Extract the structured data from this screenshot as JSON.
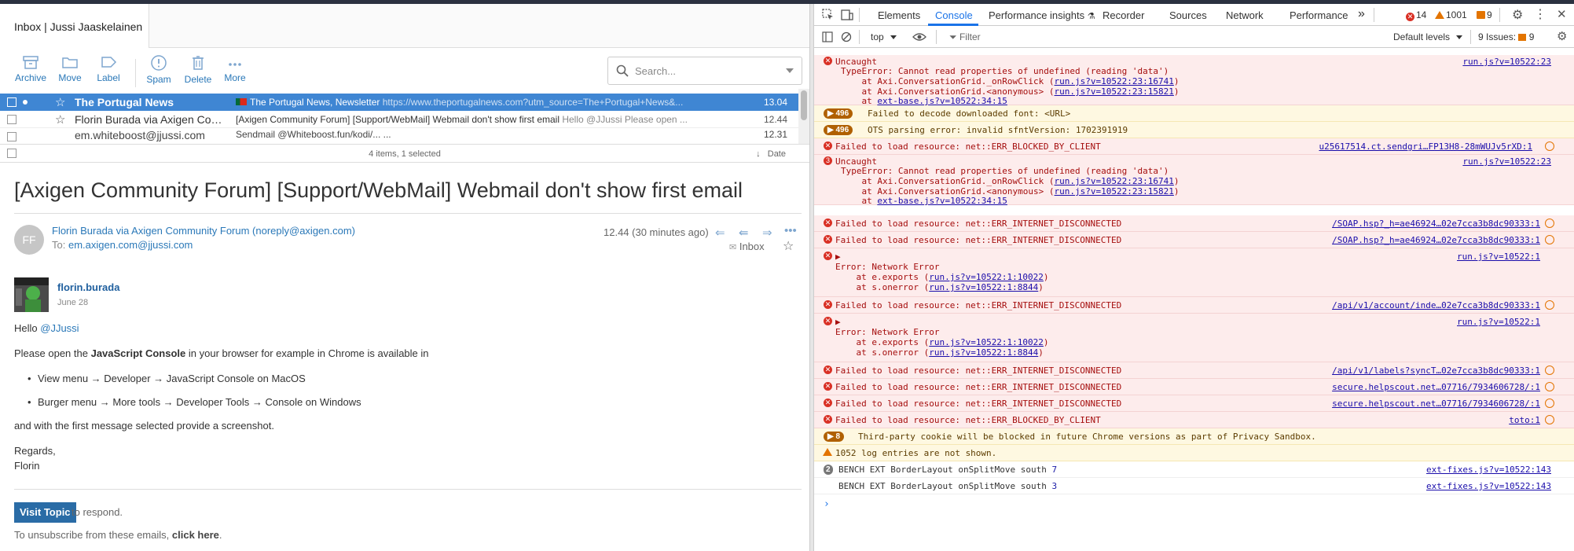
{
  "mail": {
    "tab_title": "Inbox | Jussi Jaaskelainen",
    "toolbar": {
      "archive": "Archive",
      "move": "Move",
      "label": "Label",
      "spam": "Spam",
      "delete": "Delete",
      "more": "More"
    },
    "search": {
      "placeholder": "Search..."
    },
    "rows": [
      {
        "from": "The Portugal News",
        "subject": "The Portugal News, Newsletter",
        "preview": "https://www.theportugalnews.com?utm_source=The+Portugal+News&...",
        "date": "13.04"
      },
      {
        "from": "Florin Burada via Axigen Community Forum",
        "subject": "[Axigen Community Forum] [Support/WebMail] Webmail don't show first email",
        "preview": "Hello @JJussi Please open ...",
        "date": "12.44"
      },
      {
        "from": "em.whiteboost@jjussi.com",
        "subject": "Sendmail @Whiteboost.fun/kodi/... ... ",
        "preview": "",
        "date": "12.31"
      }
    ],
    "status": {
      "count": "4 items, 1 selected",
      "sort": "Date"
    },
    "message": {
      "subject": "[Axigen Community Forum] [Support/WebMail] Webmail don't show first email",
      "avatar_initials": "FF",
      "sender": "Florin Burada via Axigen Community Forum (noreply@axigen.com)",
      "to_label": "To:",
      "to_addr": "em.axigen.com@jjussi.com",
      "time": "12.44 (30 minutes ago)",
      "folder": "Inbox",
      "post_user": "florin.burada",
      "post_date": "June 28",
      "hello": "Hello",
      "mention": "@JJussi",
      "p1_a": "Please open the",
      "p1_b": "JavaScript Console",
      "p1_c": "in your browser for example in Chrome is available in",
      "bullet1": "View menu → Developer → JavaScript Console on MacOS",
      "bullet2": "Burger menu → More tools → Developer Tools → Console on Windows",
      "p2": "and with the first message selected provide a screenshot.",
      "regards": "Regards,",
      "sign": "Florin",
      "visit": "Visit Topic",
      "respond": "to respond.",
      "unsub_a": "To unsubscribe from these emails,",
      "unsub_b": "click here",
      "unsub_c": "."
    }
  },
  "devtools": {
    "tabs": [
      "Elements",
      "Console",
      "Performance insights",
      "Recorder",
      "Sources",
      "Network",
      "Performance"
    ],
    "errors": "14",
    "warnings": "1001",
    "issues_count": "9",
    "context": "top",
    "filter_placeholder": "Filter",
    "levels": "Default levels",
    "issues_label": "9 Issues:",
    "issues_badge": "9",
    "console": {
      "m1": {
        "l1": "Uncaught",
        "l2": "TypeError: Cannot read properties of undefined (reading 'data')",
        "l3a": "    at Axi.ConversationGrid._onRowClick (",
        "l3b": "run.js?v=10522:23:16741",
        "l4a": "    at Axi.ConversationGrid.<anonymous> (",
        "l4b": "run.js?v=10522:23:15821",
        "l5a": "    at ",
        "l5b": "ext-base.js?v=10522:34:15",
        "src": "run.js?v=10522:23"
      },
      "m2": {
        "count": "496",
        "text": "Failed to decode downloaded font: <URL>"
      },
      "m3": {
        "count": "496",
        "text": "OTS parsing error: invalid sfntVersion: 1702391919"
      },
      "m4": {
        "text": "Failed to load resource: net::ERR_BLOCKED_BY_CLIENT",
        "src": "u25617514.ct.sendgri…FP13H8-28mWUJv5rXD:1"
      },
      "m5": {
        "count": "3",
        "l1": "Uncaught",
        "l2": "TypeError: Cannot read properties of undefined (reading 'data')",
        "l3a": "    at Axi.ConversationGrid._onRowClick (",
        "l3b": "run.js?v=10522:23:16741",
        "l4a": "    at Axi.ConversationGrid.<anonymous> (",
        "l4b": "run.js?v=10522:23:15821",
        "l5a": "    at ",
        "l5b": "ext-base.js?v=10522:34:15",
        "src": "run.js?v=10522:23"
      },
      "m6": {
        "text": "Failed to load resource: net::ERR_INTERNET_DISCONNECTED",
        "src": "/SOAP.hsp?_h=ae46924…02e7cca3b8dc90333:1"
      },
      "m7": {
        "text": "Failed to load resource: net::ERR_INTERNET_DISCONNECTED",
        "src": "/SOAP.hsp?_h=ae46924…02e7cca3b8dc90333:1"
      },
      "m8": {
        "l1": "▶",
        "l2": "Error: Network Error",
        "l3a": "    at e.exports (",
        "l3b": "run.js?v=10522:1:10022",
        "l4a": "    at s.onerror (",
        "l4b": "run.js?v=10522:1:8844",
        "src": "run.js?v=10522:1"
      },
      "m9": {
        "text": "Failed to load resource: net::ERR_INTERNET_DISCONNECTED",
        "src": "/api/v1/account/inde…02e7cca3b8dc90333:1"
      },
      "m10": {
        "l1": "▶",
        "l2": "Error: Network Error",
        "l3a": "    at e.exports (",
        "l3b": "run.js?v=10522:1:10022",
        "l4a": "    at s.onerror (",
        "l4b": "run.js?v=10522:1:8844",
        "src": "run.js?v=10522:1"
      },
      "m11": {
        "text": "Failed to load resource: net::ERR_INTERNET_DISCONNECTED",
        "src": "/api/v1/labels?syncT…02e7cca3b8dc90333:1"
      },
      "m12": {
        "text": "Failed to load resource: net::ERR_INTERNET_DISCONNECTED",
        "src": "secure.helpscout.net…07716/7934606728/:1"
      },
      "m13": {
        "text": "Failed to load resource: net::ERR_INTERNET_DISCONNECTED",
        "src": "secure.helpscout.net…07716/7934606728/:1"
      },
      "m14": {
        "text": "Failed to load resource: net::ERR_BLOCKED_BY_CLIENT",
        "src": "toto:1"
      },
      "m15": {
        "count": "8",
        "text": "Third-party cookie will be blocked in future Chrome versions as part of Privacy Sandbox."
      },
      "m16": {
        "text": "1052 log entries are not shown."
      },
      "m17": {
        "count": "2",
        "text": "BENCH EXT BorderLayout onSplitMove south",
        "num": "7",
        "src": "ext-fixes.js?v=10522:143"
      },
      "m18": {
        "text": "BENCH EXT BorderLayout onSplitMove south",
        "num": "3",
        "src": "ext-fixes.js?v=10522:143"
      }
    }
  }
}
